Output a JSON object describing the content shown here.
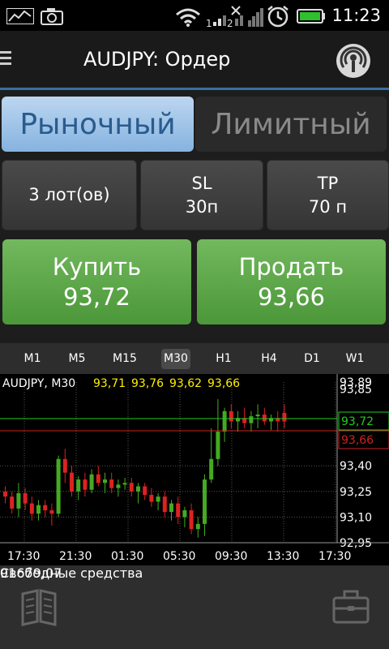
{
  "status": {
    "time": "11:23"
  },
  "header": {
    "title": "AUDJPY: Ордер"
  },
  "tabs": {
    "market": "Рыночный",
    "limit": "Лимитный"
  },
  "params": {
    "lots": "3 лот(ов)",
    "sl_label": "SL",
    "sl_value": "30п",
    "tp_label": "TP",
    "tp_value": "70 п"
  },
  "buy": {
    "label": "Купить",
    "price": "93,72"
  },
  "sell": {
    "label": "Продать",
    "price": "93,66"
  },
  "timeframes": [
    "M1",
    "M5",
    "M15",
    "M30",
    "H1",
    "H4",
    "D1",
    "W1"
  ],
  "selected_timeframe": "M30",
  "chart": {
    "symbol_label": "AUDJPY, M30",
    "ohlc": [
      "93,71",
      "93,76",
      "93,62",
      "93,66"
    ],
    "y_ticks": [
      "93,89",
      "93,85",
      "93,72",
      "93,66",
      "93,40",
      "93,25",
      "93,10",
      "92,95"
    ],
    "x_ticks": [
      "17:30",
      "21:30",
      "01:30",
      "05:30",
      "09:30",
      "13:30",
      "17:30"
    ],
    "bid_line_label": "93,72",
    "ask_line_label": "93,66",
    "colors": {
      "up": "#44aa22",
      "down": "#dd2222",
      "bid": "#22cc22",
      "ask": "#cc2222",
      "ohlc": "#ffee00"
    }
  },
  "chart_data": {
    "type": "candlestick",
    "title": "AUDJPY, M30",
    "yticks": [
      93.89,
      93.85,
      93.72,
      93.66,
      93.4,
      93.25,
      93.1,
      92.95
    ],
    "ylim": [
      92.95,
      93.89
    ],
    "xticks": [
      "17:30",
      "21:30",
      "01:30",
      "05:30",
      "09:30",
      "13:30",
      "17:30"
    ],
    "candles": [
      {
        "o": 93.25,
        "h": 93.28,
        "l": 93.18,
        "c": 93.22
      },
      {
        "o": 93.22,
        "h": 93.25,
        "l": 93.12,
        "c": 93.15
      },
      {
        "o": 93.15,
        "h": 93.3,
        "l": 93.1,
        "c": 93.24
      },
      {
        "o": 93.24,
        "h": 93.27,
        "l": 93.14,
        "c": 93.18
      },
      {
        "o": 93.18,
        "h": 93.22,
        "l": 93.08,
        "c": 93.12
      },
      {
        "o": 93.12,
        "h": 93.2,
        "l": 93.08,
        "c": 93.17
      },
      {
        "o": 93.17,
        "h": 93.2,
        "l": 93.1,
        "c": 93.14
      },
      {
        "o": 93.14,
        "h": 93.18,
        "l": 93.05,
        "c": 93.12
      },
      {
        "o": 93.12,
        "h": 93.46,
        "l": 93.1,
        "c": 93.44
      },
      {
        "o": 93.44,
        "h": 93.5,
        "l": 93.3,
        "c": 93.36
      },
      {
        "o": 93.36,
        "h": 93.4,
        "l": 93.22,
        "c": 93.25
      },
      {
        "o": 93.25,
        "h": 93.34,
        "l": 93.2,
        "c": 93.32
      },
      {
        "o": 93.32,
        "h": 93.36,
        "l": 93.22,
        "c": 93.26
      },
      {
        "o": 93.26,
        "h": 93.38,
        "l": 93.24,
        "c": 93.35
      },
      {
        "o": 93.35,
        "h": 93.4,
        "l": 93.28,
        "c": 93.3
      },
      {
        "o": 93.3,
        "h": 93.36,
        "l": 93.24,
        "c": 93.32
      },
      {
        "o": 93.32,
        "h": 93.36,
        "l": 93.24,
        "c": 93.27
      },
      {
        "o": 93.27,
        "h": 93.32,
        "l": 93.22,
        "c": 93.29
      },
      {
        "o": 93.29,
        "h": 93.33,
        "l": 93.26,
        "c": 93.3
      },
      {
        "o": 93.3,
        "h": 93.33,
        "l": 93.22,
        "c": 93.25
      },
      {
        "o": 93.25,
        "h": 93.3,
        "l": 93.18,
        "c": 93.28
      },
      {
        "o": 93.28,
        "h": 93.3,
        "l": 93.2,
        "c": 93.23
      },
      {
        "o": 93.23,
        "h": 93.27,
        "l": 93.16,
        "c": 93.19
      },
      {
        "o": 93.19,
        "h": 93.24,
        "l": 93.14,
        "c": 93.22
      },
      {
        "o": 93.22,
        "h": 93.25,
        "l": 93.1,
        "c": 93.13
      },
      {
        "o": 93.13,
        "h": 93.2,
        "l": 93.08,
        "c": 93.18
      },
      {
        "o": 93.18,
        "h": 93.22,
        "l": 93.06,
        "c": 93.1
      },
      {
        "o": 93.1,
        "h": 93.16,
        "l": 93.04,
        "c": 93.14
      },
      {
        "o": 93.14,
        "h": 93.18,
        "l": 93.0,
        "c": 93.03
      },
      {
        "o": 93.03,
        "h": 93.1,
        "l": 92.98,
        "c": 93.06
      },
      {
        "o": 93.06,
        "h": 93.35,
        "l": 92.99,
        "c": 93.32
      },
      {
        "o": 93.32,
        "h": 93.62,
        "l": 93.3,
        "c": 93.44
      },
      {
        "o": 93.44,
        "h": 93.79,
        "l": 93.4,
        "c": 93.6
      },
      {
        "o": 93.6,
        "h": 93.74,
        "l": 93.54,
        "c": 93.72
      },
      {
        "o": 93.72,
        "h": 93.76,
        "l": 93.62,
        "c": 93.66
      },
      {
        "o": 93.66,
        "h": 93.72,
        "l": 93.6,
        "c": 93.68
      },
      {
        "o": 93.68,
        "h": 93.74,
        "l": 93.62,
        "c": 93.65
      },
      {
        "o": 93.65,
        "h": 93.72,
        "l": 93.6,
        "c": 93.69
      },
      {
        "o": 93.69,
        "h": 93.76,
        "l": 93.62,
        "c": 93.7
      },
      {
        "o": 93.7,
        "h": 93.74,
        "l": 93.64,
        "c": 93.66
      },
      {
        "o": 93.66,
        "h": 93.7,
        "l": 93.61,
        "c": 93.68
      },
      {
        "o": 93.68,
        "h": 93.72,
        "l": 93.6,
        "c": 93.66
      },
      {
        "o": 93.71,
        "h": 93.76,
        "l": 93.62,
        "c": 93.66
      }
    ]
  },
  "footer": {
    "label": "Свободные средства",
    "value": "91679,07"
  }
}
